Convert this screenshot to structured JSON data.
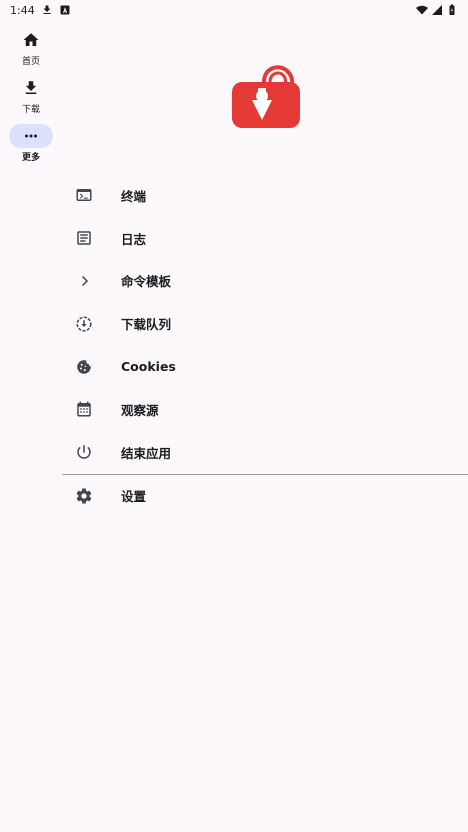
{
  "status_bar": {
    "time": "1:44",
    "icons": [
      "download-icon",
      "a-notification-icon",
      "wifi-icon",
      "signal-icon",
      "battery-icon"
    ]
  },
  "rail": {
    "items": [
      {
        "label": "首页",
        "icon": "home-icon",
        "active": false
      },
      {
        "label": "下载",
        "icon": "download-icon",
        "active": false
      },
      {
        "label": "更多",
        "icon": "more-horiz-icon",
        "active": true
      }
    ]
  },
  "logo": {
    "icon": "app-logo-icon",
    "color": "#e53935"
  },
  "menu": {
    "items": [
      {
        "label": "终端",
        "icon": "terminal-icon"
      },
      {
        "label": "日志",
        "icon": "article-icon"
      },
      {
        "label": "命令模板",
        "icon": "chevron-right-icon"
      },
      {
        "label": "下载队列",
        "icon": "download-queue-icon"
      },
      {
        "label": "Cookies",
        "icon": "cookie-icon"
      },
      {
        "label": "观察源",
        "icon": "calendar-icon"
      },
      {
        "label": "结束应用",
        "icon": "power-icon"
      }
    ],
    "settings": {
      "label": "设置",
      "icon": "gear-icon"
    }
  },
  "colors": {
    "background": "#fcf8fc",
    "active_pill": "#dbe1fb",
    "icon": "#44474f",
    "brand_red": "#e53935"
  }
}
